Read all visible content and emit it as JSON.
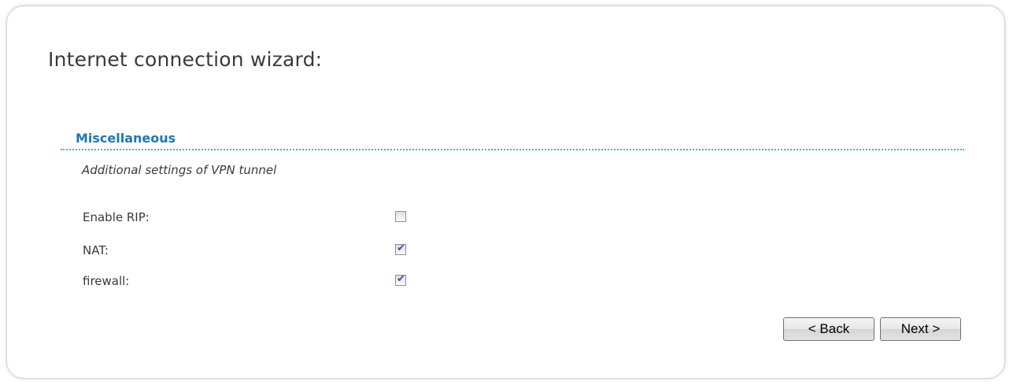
{
  "page": {
    "title": "Internet connection wizard:"
  },
  "section": {
    "title": "Miscellaneous",
    "description": "Additional settings of VPN tunnel"
  },
  "options": [
    {
      "label": "Enable RIP:",
      "checked": false
    },
    {
      "label": "NAT:",
      "checked": true
    },
    {
      "label": "firewall:",
      "checked": true
    }
  ],
  "buttons": {
    "back_label": "< Back",
    "next_label": "Next >"
  },
  "colors": {
    "section_title": "#1a78b8",
    "divider": "#5aa6d8",
    "checkmark": "#3c56a3",
    "text": "#3a3a3a"
  },
  "icons": {
    "checkmark": "checkmark-icon"
  }
}
